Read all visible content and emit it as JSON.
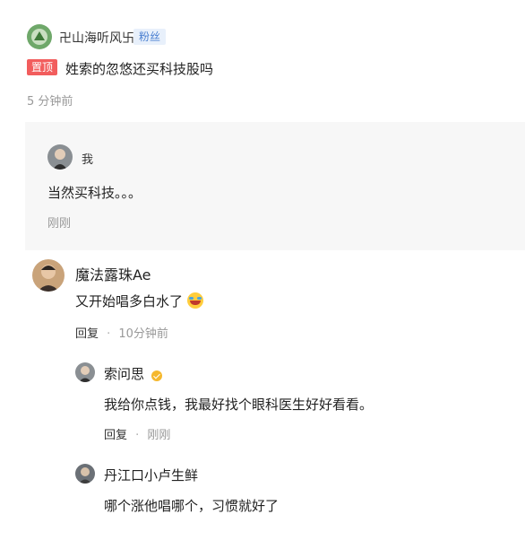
{
  "post": {
    "author": "卍山海听风卐",
    "fan_badge": "粉丝",
    "pin_badge": "置顶",
    "text": "姓索的忽悠还买科技股吗",
    "time": "5 分钟前"
  },
  "self_reply": {
    "author": "我",
    "text": "当然买科技。。。",
    "time": "刚刚"
  },
  "comments": [
    {
      "author": "魔法露珠Ae",
      "text": "又开始唱多白水了",
      "reply_label": "回复",
      "separator": "·",
      "time": "10分钟前"
    }
  ],
  "sub_replies": [
    {
      "author": "索问思",
      "text": "我给你点钱，我最好找个眼科医生好好看看。",
      "reply_label": "回复",
      "separator": "·",
      "time": "刚刚"
    },
    {
      "author": "丹江口小卢生鲜",
      "text": "哪个涨他唱哪个，习惯就好了"
    }
  ],
  "colors": {
    "pin_badge": "#f25d5d",
    "fan_badge_text": "#4a7fd0",
    "verify_badge": "#f5b82e"
  }
}
